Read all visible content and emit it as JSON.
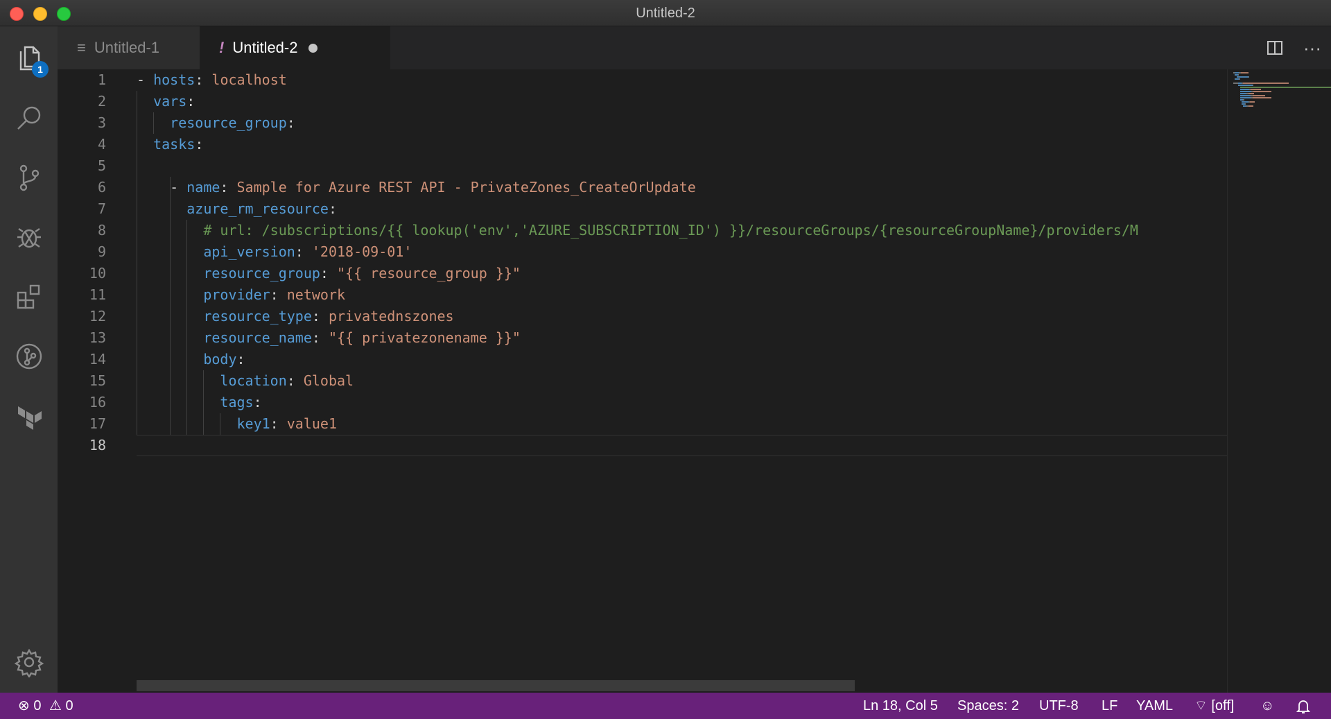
{
  "window": {
    "title": "Untitled-2"
  },
  "activity_bar": {
    "items": [
      "files-icon",
      "search-icon",
      "source-control-icon",
      "debug-icon",
      "extensions-icon",
      "git-graph-icon",
      "terraform-icon"
    ],
    "explorer_badge": "1",
    "settings": "gear-icon"
  },
  "tabs": [
    {
      "label": "Untitled-1",
      "icon": "≡"
    },
    {
      "label": "Untitled-2",
      "icon": "!"
    }
  ],
  "tab_actions": {
    "split": "split-editor-icon",
    "more": "···"
  },
  "editor": {
    "line_numbers": [
      "1",
      "2",
      "3",
      "4",
      "5",
      "6",
      "7",
      "8",
      "9",
      "10",
      "11",
      "12",
      "13",
      "14",
      "15",
      "16",
      "17",
      "18"
    ],
    "active_line": 18,
    "lines": [
      [
        {
          "t": "- ",
          "c": "p"
        },
        {
          "t": "hosts",
          "c": "k"
        },
        {
          "t": ": ",
          "c": "p"
        },
        {
          "t": "localhost",
          "c": "s"
        }
      ],
      [
        {
          "t": "  ",
          "c": "p"
        },
        {
          "t": "vars",
          "c": "k"
        },
        {
          "t": ":",
          "c": "p"
        }
      ],
      [
        {
          "t": "    ",
          "c": "p"
        },
        {
          "t": "resource_group",
          "c": "k"
        },
        {
          "t": ":",
          "c": "p"
        }
      ],
      [
        {
          "t": "  ",
          "c": "p"
        },
        {
          "t": "tasks",
          "c": "k"
        },
        {
          "t": ":",
          "c": "p"
        }
      ],
      [],
      [
        {
          "t": "    - ",
          "c": "p"
        },
        {
          "t": "name",
          "c": "k"
        },
        {
          "t": ": ",
          "c": "p"
        },
        {
          "t": "Sample for Azure REST API - PrivateZones_CreateOrUpdate",
          "c": "s"
        }
      ],
      [
        {
          "t": "      ",
          "c": "p"
        },
        {
          "t": "azure_rm_resource",
          "c": "k"
        },
        {
          "t": ":",
          "c": "p"
        }
      ],
      [
        {
          "t": "        ",
          "c": "p"
        },
        {
          "t": "# url: /subscriptions/{{ lookup('env','AZURE_SUBSCRIPTION_ID') }}/resourceGroups/{resourceGroupName}/providers/M",
          "c": "c"
        }
      ],
      [
        {
          "t": "        ",
          "c": "p"
        },
        {
          "t": "api_version",
          "c": "k"
        },
        {
          "t": ": ",
          "c": "p"
        },
        {
          "t": "'2018-09-01'",
          "c": "s"
        }
      ],
      [
        {
          "t": "        ",
          "c": "p"
        },
        {
          "t": "resource_group",
          "c": "k"
        },
        {
          "t": ": ",
          "c": "p"
        },
        {
          "t": "\"{{ resource_group }}\"",
          "c": "s"
        }
      ],
      [
        {
          "t": "        ",
          "c": "p"
        },
        {
          "t": "provider",
          "c": "k"
        },
        {
          "t": ": ",
          "c": "p"
        },
        {
          "t": "network",
          "c": "s"
        }
      ],
      [
        {
          "t": "        ",
          "c": "p"
        },
        {
          "t": "resource_type",
          "c": "k"
        },
        {
          "t": ": ",
          "c": "p"
        },
        {
          "t": "privatednszones",
          "c": "s"
        }
      ],
      [
        {
          "t": "        ",
          "c": "p"
        },
        {
          "t": "resource_name",
          "c": "k"
        },
        {
          "t": ": ",
          "c": "p"
        },
        {
          "t": "\"{{ privatezonename }}\"",
          "c": "s"
        }
      ],
      [
        {
          "t": "        ",
          "c": "p"
        },
        {
          "t": "body",
          "c": "k"
        },
        {
          "t": ":",
          "c": "p"
        }
      ],
      [
        {
          "t": "          ",
          "c": "p"
        },
        {
          "t": "location",
          "c": "k"
        },
        {
          "t": ": ",
          "c": "p"
        },
        {
          "t": "Global",
          "c": "s"
        }
      ],
      [
        {
          "t": "          ",
          "c": "p"
        },
        {
          "t": "tags",
          "c": "k"
        },
        {
          "t": ":",
          "c": "p"
        }
      ],
      [
        {
          "t": "            ",
          "c": "p"
        },
        {
          "t": "key1",
          "c": "k"
        },
        {
          "t": ": ",
          "c": "p"
        },
        {
          "t": "value1",
          "c": "s"
        }
      ],
      []
    ]
  },
  "status_bar": {
    "errors": "0",
    "warnings": "0",
    "position": "Ln 18, Col 5",
    "spaces": "Spaces: 2",
    "encoding": "UTF-8",
    "eol": "LF",
    "language": "YAML",
    "live_share": "[off]",
    "feedback": "smiley-icon",
    "notifications": "bell-icon"
  },
  "colors": {
    "status_bar": "#68217a",
    "keyword": "#569cd6",
    "string": "#ce9178",
    "comment": "#6a9955",
    "editor_bg": "#1e1e1e"
  }
}
